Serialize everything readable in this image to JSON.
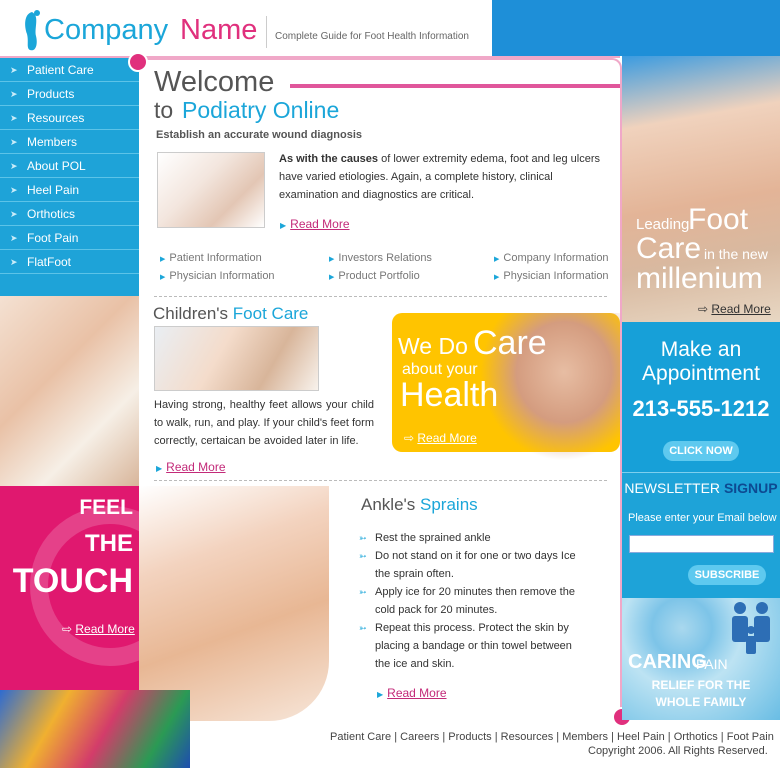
{
  "header": {
    "logo_company": "Company",
    "logo_name": "Name",
    "tagline": "Complete Guide for Foot Health Information"
  },
  "nav": {
    "items": [
      "Patient Care",
      "Products",
      "Resources",
      "Members",
      "About POL",
      "Heel Pain",
      "Orthotics",
      "Foot Pain",
      "FlatFoot"
    ]
  },
  "touch_promo": {
    "line1": "FEEL",
    "line2": "THE",
    "line3": "TOUCH",
    "read_more": "Read More"
  },
  "welcome": {
    "title": "Welcome",
    "to": "to",
    "site": "Podiatry Online",
    "subtitle": "Establish an accurate wound diagnosis",
    "intro_bold": "As with the causes",
    "intro_rest": " of lower extremity edema, foot and leg ulcers have varied etiologies. Again, a complete history, clinical examination and diagnostics are critical.",
    "read_more": "Read More"
  },
  "links": [
    "Patient Information",
    "Investors Relations",
    "Company Information",
    "Physician Information",
    "Product Portfolio",
    "Physician Information"
  ],
  "children": {
    "title_a": "Children's",
    "title_b": "Foot Care",
    "text": "Having strong, healthy feet allows your child to walk, run, and play. If your child's feet form correctly, certaican be avoided later in life.",
    "read_more": "Read More"
  },
  "care_promo": {
    "we_do": "We Do",
    "care": "Care",
    "about": "about your",
    "health": "Health",
    "read_more": "Read More"
  },
  "ankle": {
    "title_a": "Ankle's",
    "title_b": "Sprains",
    "bullets": [
      "Rest the sprained ankle",
      "Do not stand on it for one or two days Ice the sprain often.",
      "Apply ice for 20 minutes then remove the cold pack for 20 minutes.",
      "Repeat this process. Protect the skin by placing a bandage or thin towel between the ice and skin."
    ],
    "read_more": "Read More"
  },
  "leading": {
    "leading": "Leading",
    "foot": "Foot",
    "care": "Care",
    "in_the_new": "in the new",
    "millenium": "millenium",
    "read_more": "Read More"
  },
  "appointment": {
    "line1": "Make an",
    "line2": "Appointment",
    "phone": "213-555-1212",
    "button": "CLICK NOW"
  },
  "newsletter": {
    "title": "NEWSLETTER",
    "signup": "SIGNUP",
    "prompt": "Please enter your Email below",
    "email_value": "",
    "button": "SUBSCRIBE"
  },
  "family": {
    "caring": "CARING",
    "pain": "PAIN",
    "relief": "RELIEF FOR THE",
    "whole": "WHOLE FAMILY"
  },
  "footer": {
    "links": [
      "Patient Care",
      "Careers",
      "Products",
      "Resources",
      "Members",
      "Heel Pain",
      "Orthotics",
      "Foot Pain"
    ],
    "copyright": "Copyright 2006. All Rights Reserved."
  }
}
